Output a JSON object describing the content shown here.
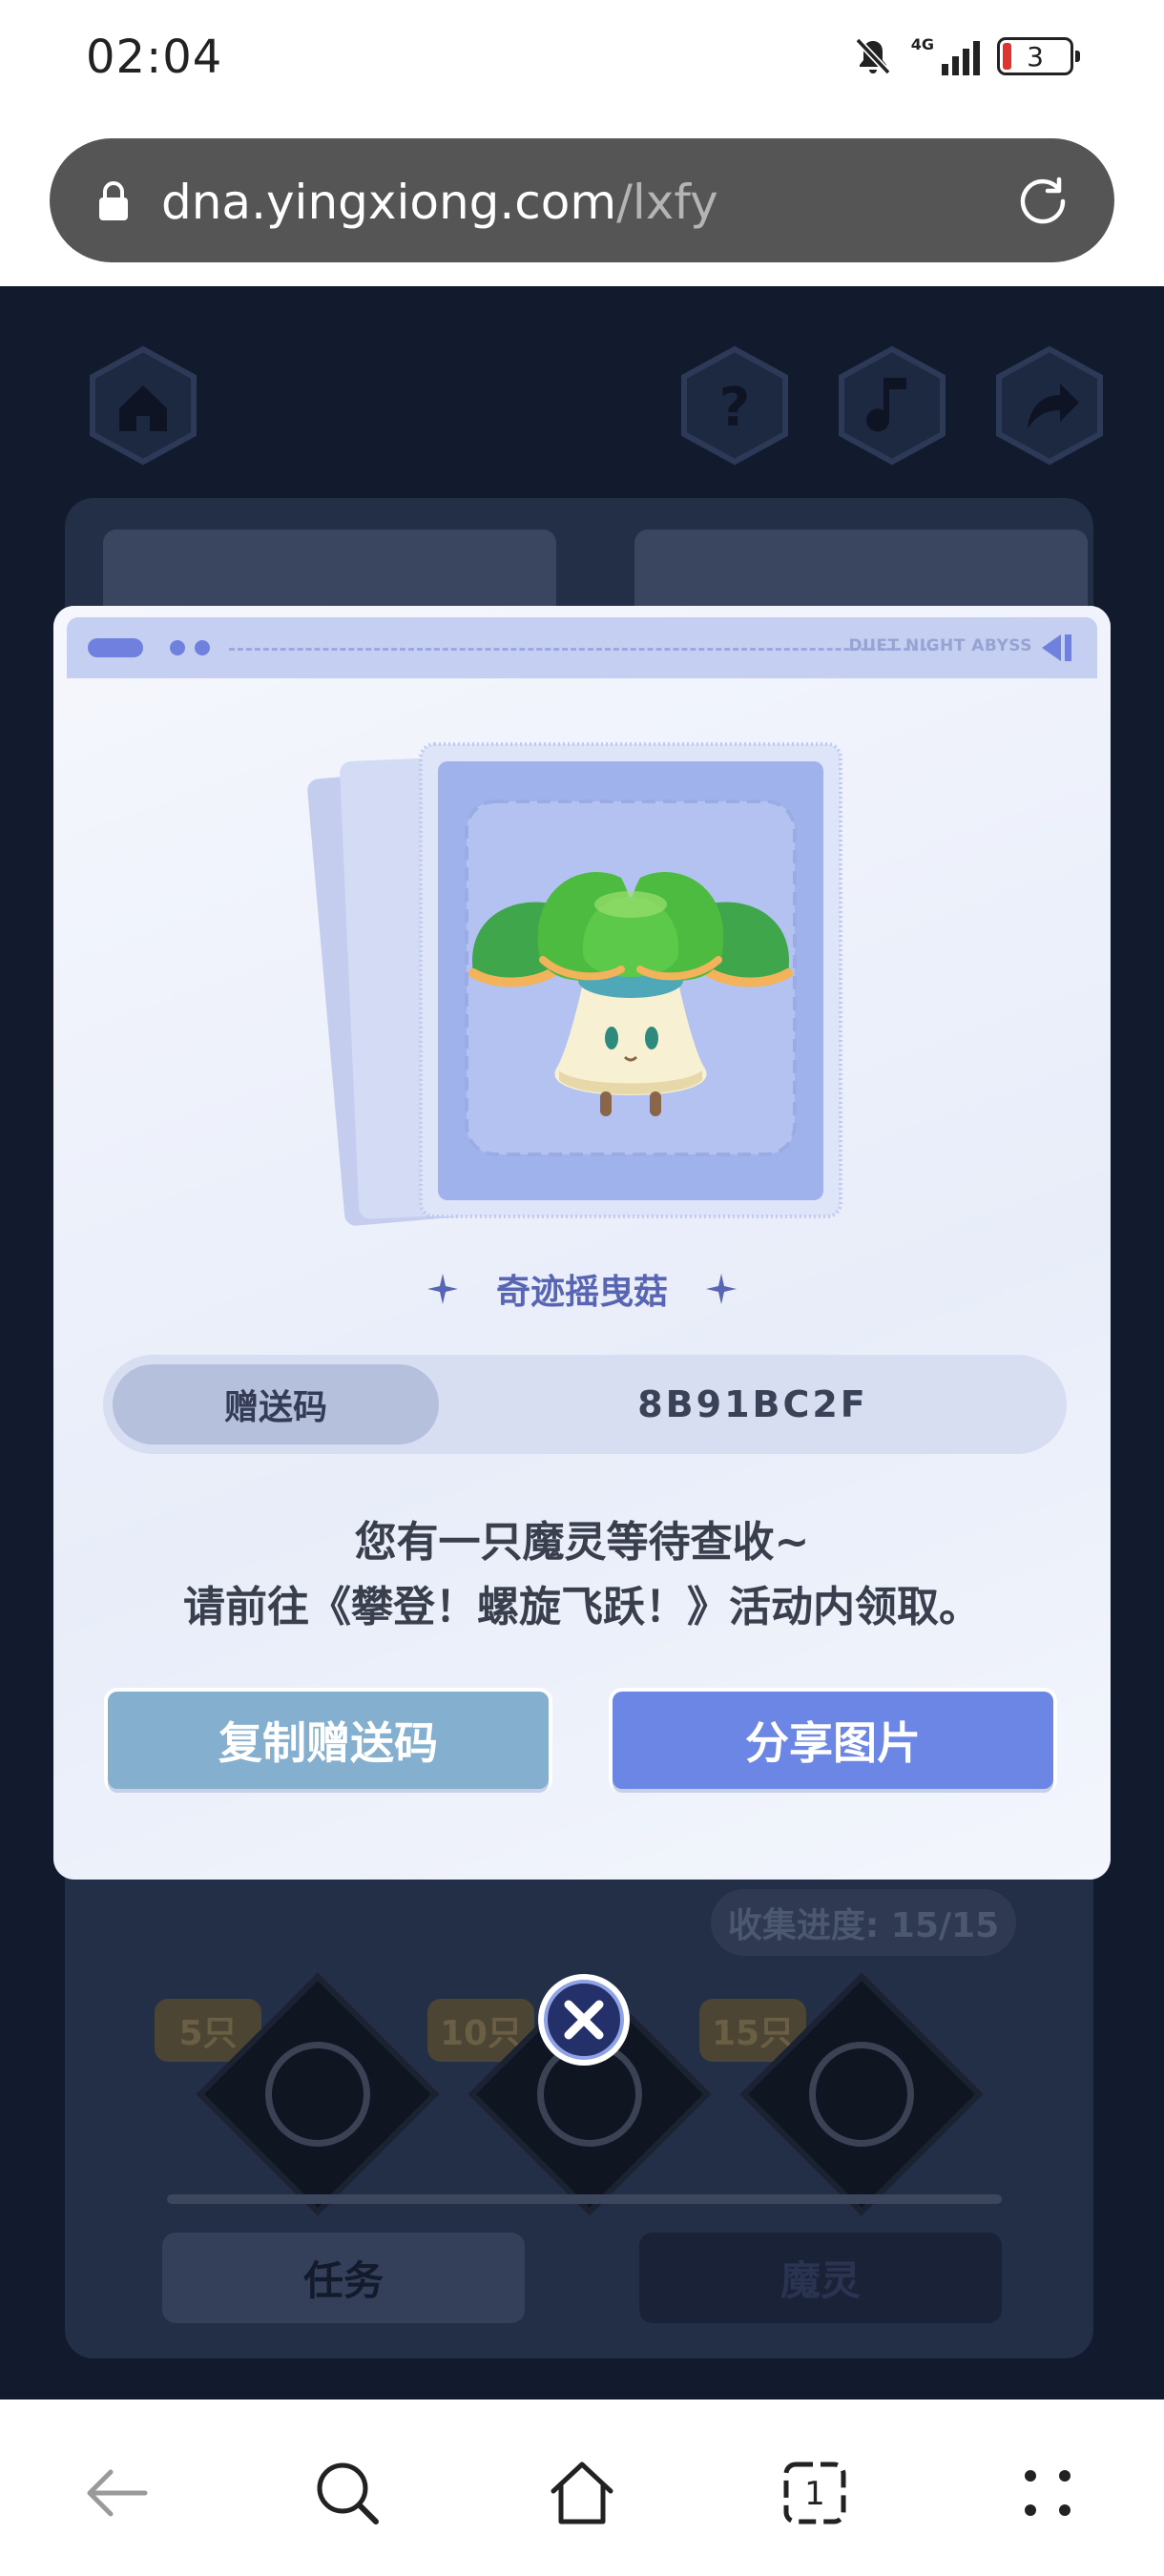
{
  "status_bar": {
    "time": "02:04",
    "network": "4G",
    "battery": "3"
  },
  "browser": {
    "url_domain": "dna.yingxiong.com",
    "url_path": "/lxfy"
  },
  "game_background": {
    "progress_label": "收集进度: 15/15",
    "milestones": [
      "5只",
      "10只",
      "15只"
    ],
    "tab_task": "任务",
    "tab_spirit": "魔灵"
  },
  "modal": {
    "header_text": "DUET NIGHT ABYSS",
    "pet_name": "奇迹摇曳菇",
    "gift_code_label": "赠送码",
    "gift_code_value": "8B91BC2F",
    "message_line1": "您有一只魔灵等待查收~",
    "message_line2": "请前往《攀登！螺旋飞跃！》活动内领取。",
    "copy_button": "复制赠送码",
    "share_button": "分享图片"
  },
  "colors": {
    "accent_blue": "#6b86e4",
    "copy_button": "#84afcf",
    "pet_name": "#5765b3",
    "battery_low": "#e0332f"
  },
  "icons": {
    "status": [
      "bell-muted-icon",
      "signal-icon",
      "battery-icon"
    ],
    "browser": [
      "lock-icon",
      "reload-icon"
    ],
    "game": [
      "home-icon",
      "help-icon",
      "music-icon",
      "share-icon"
    ],
    "nav": [
      "back-icon",
      "search-icon",
      "home-icon",
      "tabs-icon",
      "menu-icon"
    ]
  }
}
